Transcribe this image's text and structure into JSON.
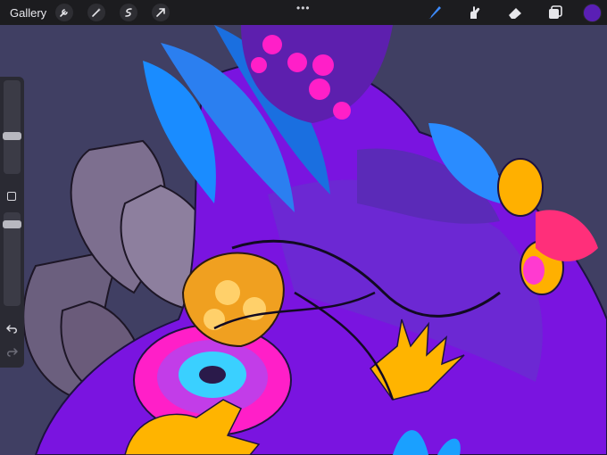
{
  "app": {
    "gallery_label": "Gallery"
  },
  "toolbar": {
    "left_tools": [
      "wrench-icon",
      "magic-wand-icon",
      "selection-icon",
      "transform-arrow-icon"
    ],
    "menu_dots": "•••",
    "right_tools": [
      "brush-icon",
      "smudge-icon",
      "eraser-icon",
      "layers-icon"
    ],
    "active_tool": "brush-icon",
    "current_color": "#5a1fb5",
    "accent_color": "#3d8bff"
  },
  "sidebar": {
    "brush_size": 0.45,
    "opacity": 0.35,
    "undo_icon": "undo-arrow-icon",
    "redo_icon": "redo-arrow-icon"
  },
  "canvas": {
    "background_color": "#403f63",
    "palette": [
      "#7a14e0",
      "#1a8cff",
      "#ff1fc8",
      "#ffb000",
      "#8a7d9e",
      "#2a1a4a"
    ]
  }
}
